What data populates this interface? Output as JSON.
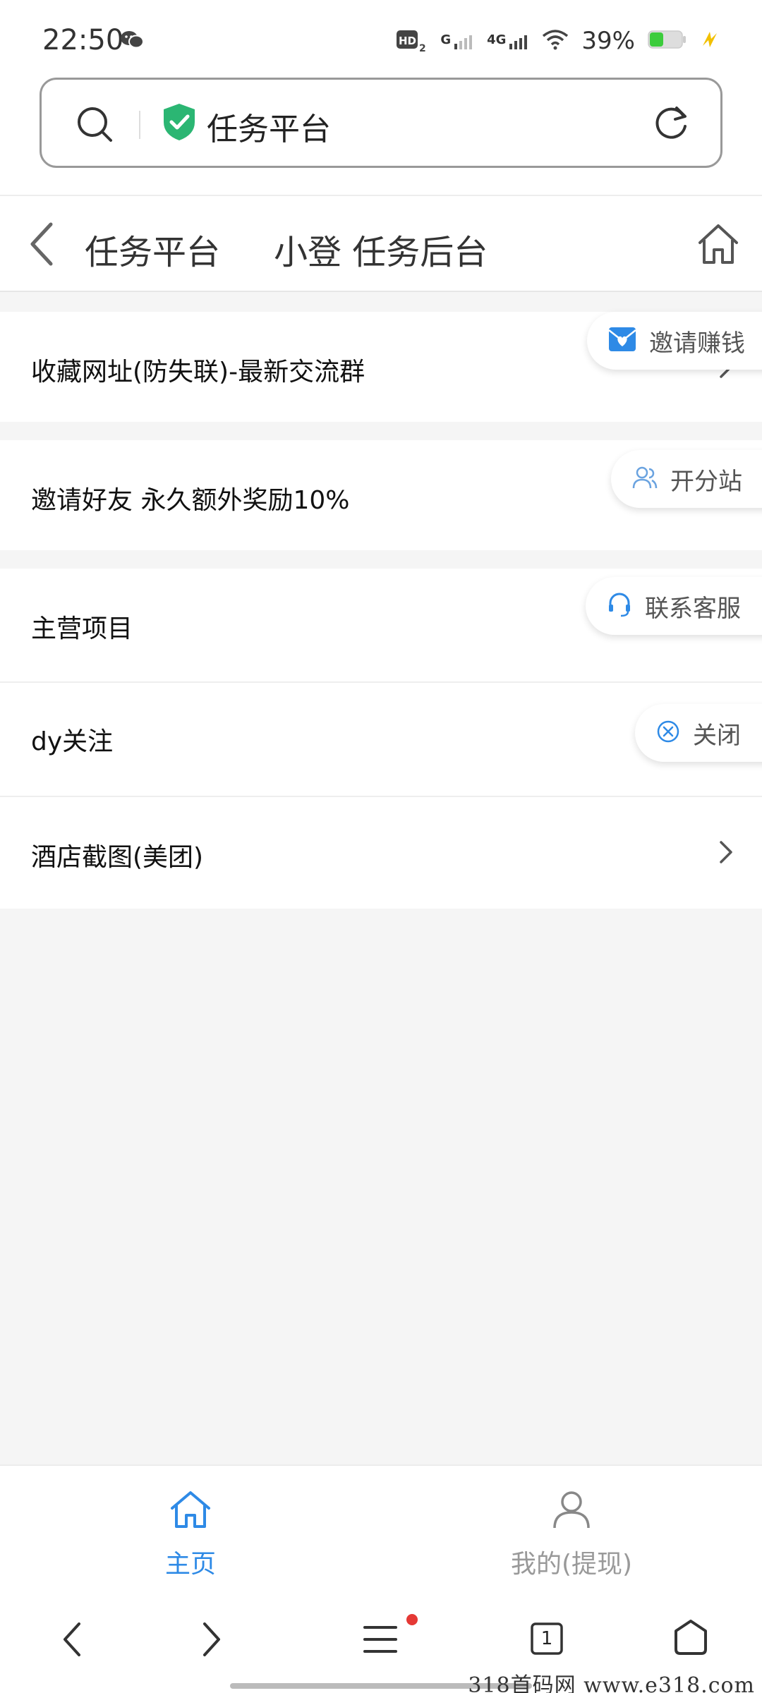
{
  "status_bar": {
    "time": "22:50",
    "network": "4G",
    "network2": "G",
    "battery": "39%",
    "icons": [
      "wechat-icon",
      "hd-icon",
      "signal-icon",
      "wifi-icon",
      "battery-icon",
      "charging-icon"
    ]
  },
  "address_bar": {
    "title": "任务平台"
  },
  "header": {
    "title": "任务平台",
    "subtitle": "小登 任务后台"
  },
  "list": {
    "items": [
      {
        "label": "收藏网址(防失联)-最新交流群"
      },
      {
        "label": "邀请好友 永久额外奖励10%"
      },
      {
        "label": "主营项目"
      },
      {
        "label": "dy关注"
      },
      {
        "label": "酒店截图(美团)"
      }
    ]
  },
  "float_menu": {
    "items": [
      {
        "label": "邀请赚钱",
        "icon": "invite-envelope-icon"
      },
      {
        "label": "开分站",
        "icon": "users-icon"
      },
      {
        "label": "联系客服",
        "icon": "headset-icon"
      },
      {
        "label": "关闭",
        "icon": "close-circle-icon"
      }
    ]
  },
  "bottom_tabs": {
    "home": "主页",
    "mine": "我的(提现)"
  },
  "browser_nav": {
    "tab_count": "1"
  },
  "watermark": "318首码网  www.e318.com",
  "colors": {
    "accent_blue": "#2e8ae6",
    "shield_green": "#2bb673",
    "badge_red": "#e53935",
    "background": "#f5f5f5"
  }
}
